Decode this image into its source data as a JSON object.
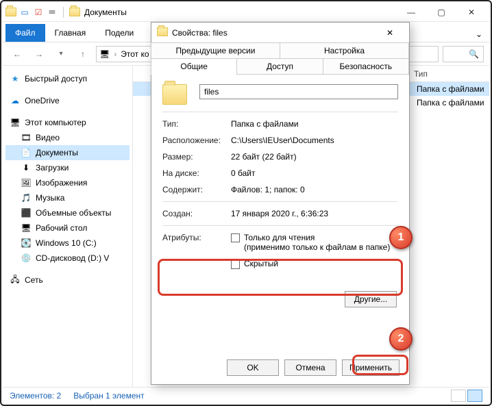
{
  "explorer": {
    "title": "Документы",
    "ribbon": {
      "file": "Файл",
      "home": "Главная",
      "share": "Подели"
    },
    "breadcrumb": "Этот ко",
    "columns": {
      "type": "Тип"
    },
    "rows": [
      {
        "type": "Папка с файлами"
      },
      {
        "type": "Папка с файлами"
      }
    ],
    "status": {
      "count": "Элементов: 2",
      "selected": "Выбран 1 элемент"
    }
  },
  "tree": {
    "quick": "Быстрый доступ",
    "onedrive": "OneDrive",
    "thispc": "Этот компьютер",
    "video": "Видео",
    "documents": "Документы",
    "downloads": "Загрузки",
    "pictures": "Изображения",
    "music": "Музыка",
    "objects3d": "Объемные объекты",
    "desktop": "Рабочий стол",
    "cdrive": "Windows 10 (C:)",
    "dvd": "CD-дисковод (D:) V",
    "network": "Сеть"
  },
  "props": {
    "title": "Свойства: files",
    "tabs": {
      "prev": "Предыдущие версии",
      "custom": "Настройка",
      "general": "Общие",
      "sharing": "Доступ",
      "security": "Безопасность"
    },
    "name": "files",
    "labels": {
      "type": "Тип:",
      "location": "Расположение:",
      "size": "Размер:",
      "sizeondisk": "На диске:",
      "contains": "Содержит:",
      "created": "Создан:",
      "attributes": "Атрибуты:"
    },
    "values": {
      "type": "Папка с файлами",
      "location": "C:\\Users\\IEUser\\Documents",
      "size": "22 байт (22 байт)",
      "sizeondisk": "0 байт",
      "contains": "Файлов: 1; папок: 0",
      "created": "17 января 2020 г., 6:36:23"
    },
    "attrs": {
      "readonly": "Только для чтения",
      "readonly_note": "(применимо только к файлам в папке)",
      "hidden": "Скрытый",
      "other": "Другие..."
    },
    "buttons": {
      "ok": "OK",
      "cancel": "Отмена",
      "apply": "Применить"
    }
  },
  "badges": {
    "one": "1",
    "two": "2"
  }
}
